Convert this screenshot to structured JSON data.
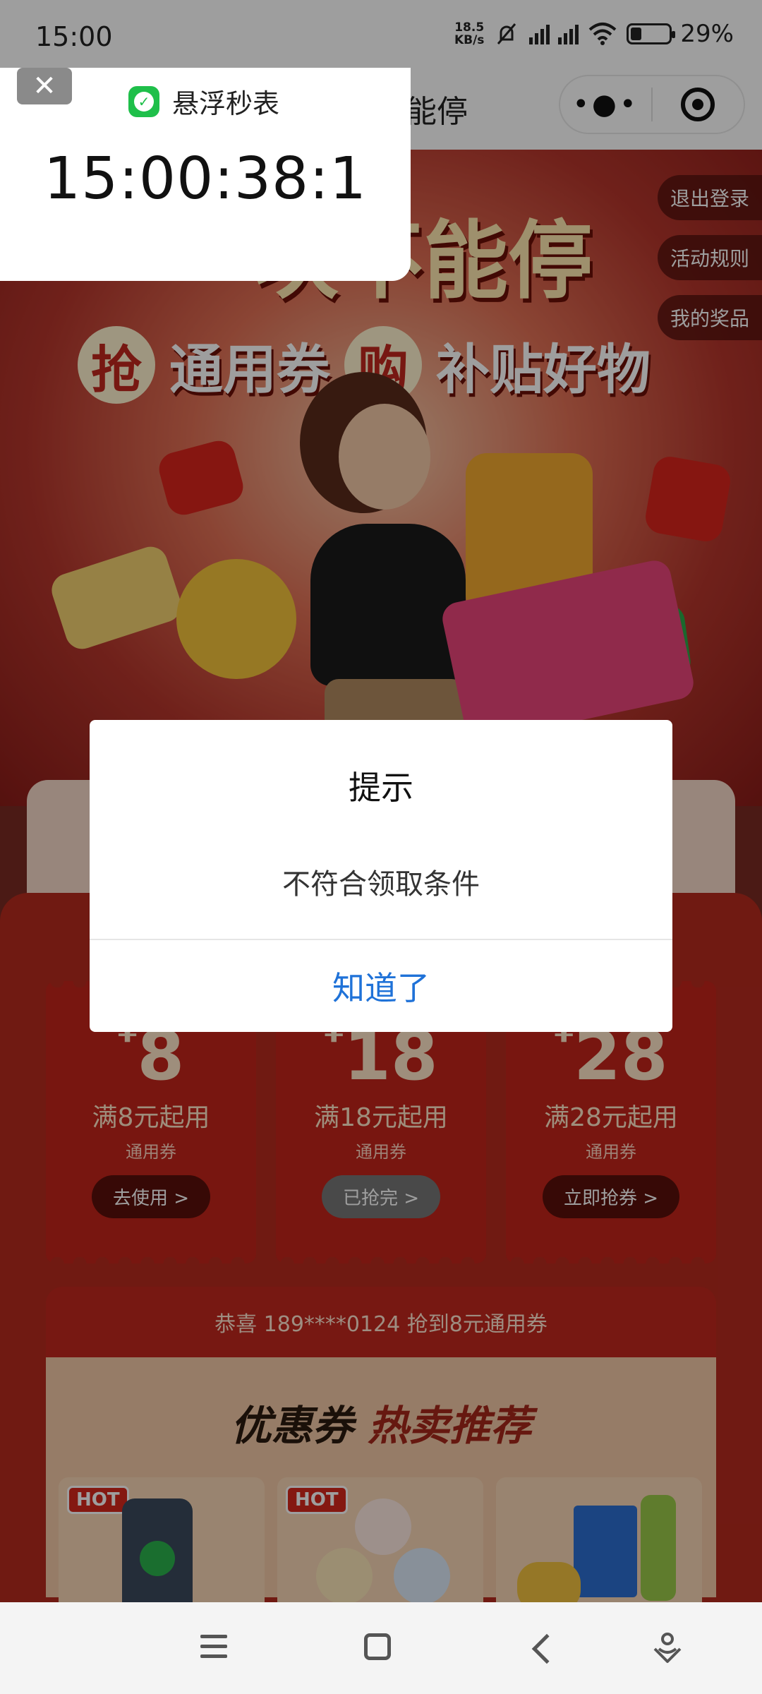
{
  "status_bar": {
    "time": "15:00",
    "net_speed_value": "18.5",
    "net_speed_unit": "KB/s",
    "battery_percent": "29%",
    "battery_level": 0.29
  },
  "navbar": {
    "title_fragment": "能停",
    "more_glyph": "•●•"
  },
  "stopwatch": {
    "close_glyph": "✕",
    "app_icon_glyph": "✓",
    "app_name": "悬浮秒表",
    "time": "15:00:38:1"
  },
  "hero": {
    "title": "一块不能停",
    "badge_left": "抢",
    "sub_left": "通用券",
    "badge_right": "购",
    "sub_right": "补贴好物"
  },
  "side_buttons": [
    "退出登录",
    "活动规则",
    "我的奖品"
  ],
  "coupons": [
    {
      "currency": "¥",
      "amount": "8",
      "condition": "满8元起用",
      "type": "通用券",
      "action": "去使用 >"
    },
    {
      "currency": "¥",
      "amount": "18",
      "condition": "满18元起用",
      "type": "通用券",
      "action": "已抢完 >"
    },
    {
      "currency": "¥",
      "amount": "28",
      "condition": "满28元起用",
      "type": "通用券",
      "action": "立即抢券 >"
    }
  ],
  "winner_ticker": "恭喜 189****0124 抢到8元通用券",
  "recommend": {
    "title_part1": "优惠券",
    "title_part2": "热卖推荐",
    "hot_label": "HOT"
  },
  "dialog": {
    "title": "提示",
    "message": "不符合领取条件",
    "confirm": "知道了"
  },
  "colors": {
    "dialog_button": "#1f72d8",
    "coupon_red": "#c2241a",
    "app_icon_green": "#1fbf4a"
  }
}
